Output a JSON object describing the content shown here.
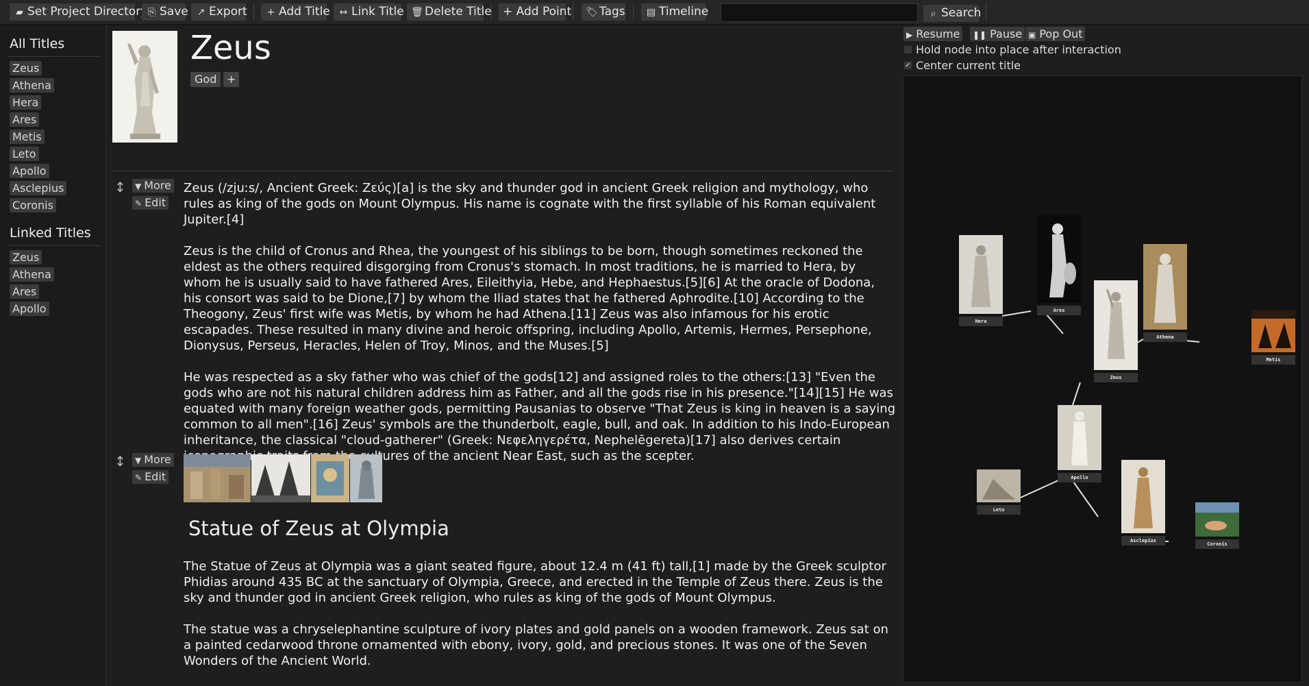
{
  "toolbar": {
    "set_project_directory": "Set Project Directory",
    "save": "Save",
    "export": "Export",
    "add_title": "Add Title",
    "link_title": "Link Title",
    "delete_title": "Delete Title",
    "add_point": "+ Add Point",
    "tags": "Tags",
    "timeline": "Timeline",
    "search_value": "",
    "search": "Search"
  },
  "sidebar": {
    "all_titles_heading": "All Titles",
    "all_titles": [
      "Zeus",
      "Athena",
      "Hera",
      "Ares",
      "Metis",
      "Leto",
      "Apollo",
      "Asclepius",
      "Coronis"
    ],
    "linked_titles_heading": "Linked Titles",
    "linked_titles": [
      "Zeus",
      "Athena",
      "Ares",
      "Apollo"
    ]
  },
  "main": {
    "title": "Zeus",
    "tags": [
      "God"
    ],
    "add_tag": "+",
    "more_label": "More",
    "edit_label": "Edit",
    "block1_paragraphs": [
      "Zeus (/zjuːs/, Ancient Greek: Ζεύς)[a] is the sky and thunder god in ancient Greek religion and mythology, who rules as king of the gods on Mount Olympus. His name is cognate with the first syllable of his Roman equivalent Jupiter.[4]",
      "Zeus is the child of Cronus and Rhea, the youngest of his siblings to be born, though sometimes reckoned the eldest as the others required disgorging from Cronus's stomach. In most traditions, he is married to Hera, by whom he is usually said to have fathered Ares, Eileithyia, Hebe, and Hephaestus.[5][6] At the oracle of Dodona, his consort was said to be Dione,[7] by whom the Iliad states that he fathered Aphrodite.[10] According to the Theogony, Zeus' first wife was Metis, by whom he had Athena.[11] Zeus was also infamous for his erotic escapades. These resulted in many divine and heroic offspring, including Apollo, Artemis, Hermes, Persephone, Dionysus, Perseus, Heracles, Helen of Troy, Minos, and the Muses.[5]",
      "He was respected as a sky father who was chief of the gods[12] and assigned roles to the others:[13] \"Even the gods who are not his natural children address him as Father, and all the gods rise in his presence.\"[14][15] He was equated with many foreign weather gods, permitting Pausanias to observe \"That Zeus is king in heaven is a saying common to all men\".[16] Zeus' symbols are the thunderbolt, eagle, bull, and oak. In addition to his Indo-European inheritance, the classical \"cloud-gatherer\" (Greek: Νεφεληγερέτα, Nephelēgereta)[17] also derives certain iconographic traits from the cultures of the ancient Near East, such as the scepter."
    ],
    "section_title": "Statue of Zeus at Olympia",
    "block2_paragraphs": [
      "The Statue of Zeus at Olympia was a giant seated figure, about 12.4 m (41 ft) tall,[1] made by the Greek sculptor Phidias around 435 BC at the sanctuary of Olympia, Greece, and erected in the Temple of Zeus there. Zeus is the sky and thunder god in ancient Greek religion, who rules as king of the gods of Mount Olympus.",
      "The statue was a chryselephantine sculpture of ivory plates and gold panels on a wooden framework. Zeus sat on a painted cedarwood throne ornamented with ebony, ivory, gold, and precious stones. It was one of the Seven Wonders of the Ancient World."
    ]
  },
  "graph": {
    "resume": "Resume",
    "pause": "Pause",
    "pop_out": "Pop Out",
    "hold_node_label": "Hold node into place after interaction",
    "hold_node_checked": false,
    "center_label": "Center current title",
    "center_checked": true,
    "nodes": {
      "hera": "Hera",
      "ares": "Ares",
      "zeus": "Zeus",
      "athena": "Athena",
      "metis": "Metis",
      "apollo": "Apollo",
      "leto": "Leto",
      "asclepius": "Asclepius",
      "coronis": "Coronis"
    }
  }
}
